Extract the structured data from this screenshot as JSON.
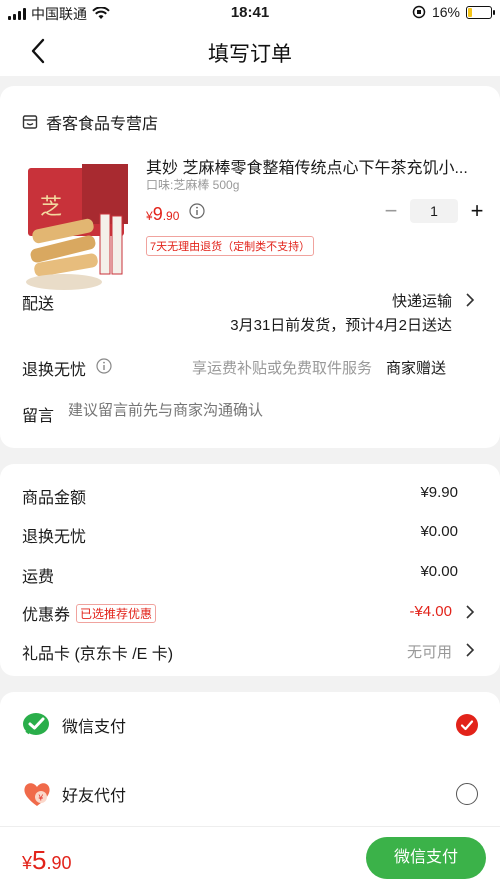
{
  "status": {
    "carrier": "中国联通",
    "time": "18:41",
    "battery": "16%",
    "battery_level": 0.16
  },
  "nav": {
    "title": "填写订单"
  },
  "shop": {
    "name": "香客食品专营店"
  },
  "product": {
    "title": "其妙 芝麻棒零食整箱传统点心下午茶充饥小...",
    "spec": "口味:芝麻棒 500g",
    "price_symbol": "¥",
    "price_int": "9",
    "price_dec": ".90",
    "quantity": "1",
    "tag": "7天无理由退货（定制类不支持）",
    "image_caption": "芝"
  },
  "delivery": {
    "label": "配送",
    "method": "快递运输",
    "schedule": "3月31日前发货，预计4月2日送达"
  },
  "returns": {
    "label": "退换无忧",
    "desc": "享运费补贴或免费取件服务",
    "value": "商家赠送"
  },
  "message": {
    "label": "留言",
    "placeholder": "建议留言前先与商家沟通确认"
  },
  "summary": {
    "goods_label": "商品金额",
    "goods_value": "¥9.90",
    "returns_label": "退换无忧",
    "returns_value": "¥0.00",
    "shipping_label": "运费",
    "shipping_value": "¥0.00",
    "coupon_label": "优惠券",
    "coupon_badge": "已选推荐优惠",
    "coupon_value": "-¥4.00",
    "giftcard_label": "礼品卡 (京东卡 /E 卡)",
    "giftcard_value": "无可用"
  },
  "payment": {
    "wechat_label": "微信支付",
    "friend_label": "好友代付"
  },
  "bottom": {
    "total_symbol": "¥",
    "total_int": "5",
    "total_dec": ".90",
    "pay_button": "微信支付"
  },
  "colors": {
    "accent": "#e2231a",
    "wechat": "#3bb249"
  }
}
